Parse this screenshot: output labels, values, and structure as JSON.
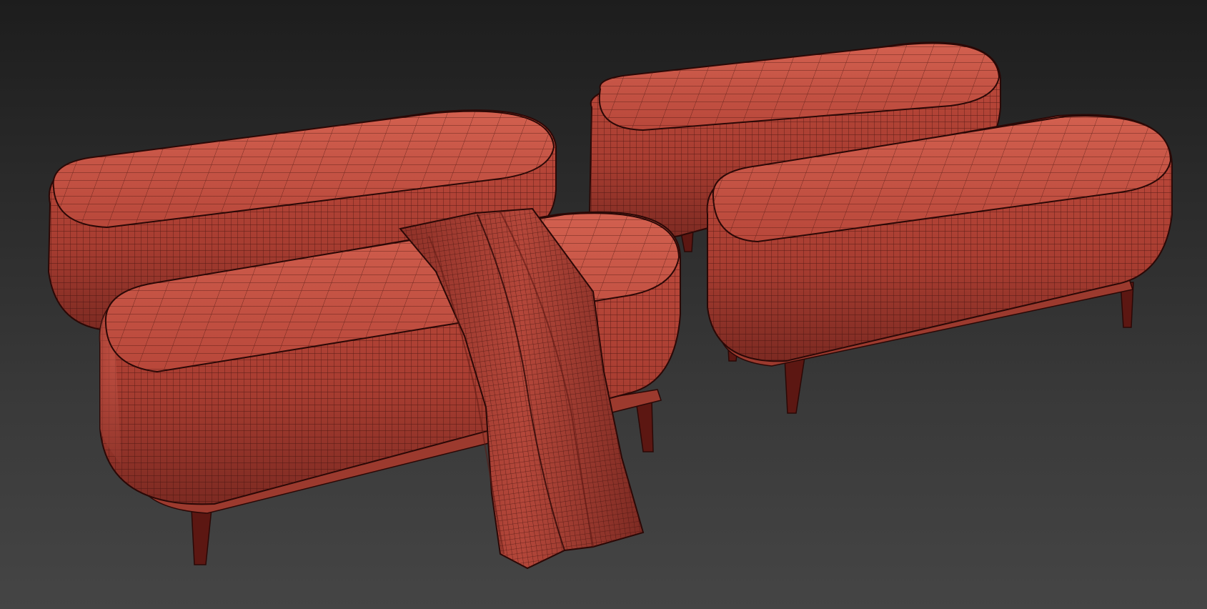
{
  "scene": {
    "view": "3d-viewport-wireframe-render",
    "benches": [
      {
        "id": "bench-back-left",
        "shape": "rounded-oblong-upholstered",
        "legs": 4
      },
      {
        "id": "bench-back-right",
        "shape": "rounded-oblong-upholstered",
        "legs": 4
      },
      {
        "id": "bench-front-right",
        "shape": "rounded-oblong-upholstered",
        "legs": 4
      },
      {
        "id": "bench-front-left",
        "shape": "rounded-oblong-upholstered",
        "legs": 4,
        "has_throw_blanket": true
      }
    ]
  },
  "colors": {
    "background_top": "#1d1d1d",
    "background_bottom": "#454545",
    "mesh_base": "#b8473a",
    "mesh_top_light": "#cf5a4a",
    "mesh_dark": "#7c2a22",
    "wire": "#3a0e0a",
    "leg": "#5c1712"
  }
}
